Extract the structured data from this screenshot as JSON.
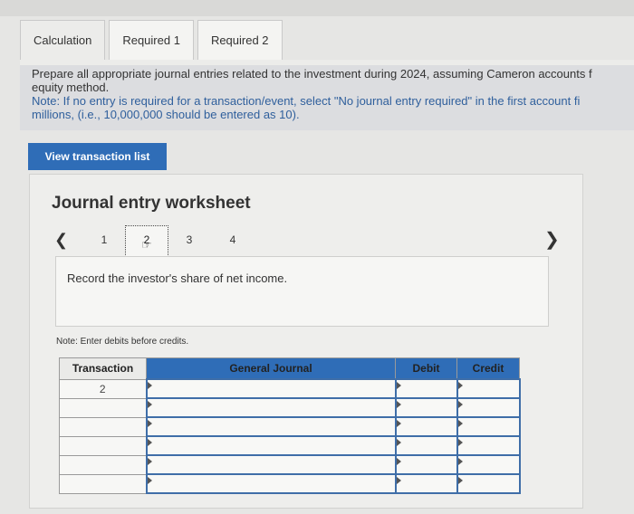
{
  "tabs": [
    {
      "label": "Calculation"
    },
    {
      "label": "Required 1"
    },
    {
      "label": "Required 2"
    }
  ],
  "instructions": {
    "line1": "Prepare all appropriate journal entries related to the investment during 2024, assuming Cameron accounts f",
    "line2": "equity method.",
    "note_line1": "Note: If no entry is required for a transaction/event, select \"No journal entry required\" in the first account fi",
    "note_line2": "millions, (i.e., 10,000,000 should be entered as 10)."
  },
  "view_button_label": "View transaction list",
  "worksheet": {
    "title": "Journal entry worksheet",
    "pages": [
      "1",
      "2",
      "3",
      "4"
    ],
    "current_page": "2",
    "description": "Record the investor's share of net income.",
    "note": "Note: Enter debits before credits."
  },
  "journal": {
    "headers": {
      "transaction": "Transaction",
      "general_journal": "General Journal",
      "debit": "Debit",
      "credit": "Credit"
    },
    "rows": [
      {
        "transaction": "2"
      },
      {
        "transaction": ""
      },
      {
        "transaction": ""
      },
      {
        "transaction": ""
      },
      {
        "transaction": ""
      },
      {
        "transaction": ""
      }
    ]
  },
  "icons": {
    "prev": "chevron-left-icon",
    "next": "chevron-right-icon",
    "cursor": "hand-pointer-icon"
  },
  "colors": {
    "accent": "#2f6db7",
    "note_text": "#2f5f9c"
  }
}
